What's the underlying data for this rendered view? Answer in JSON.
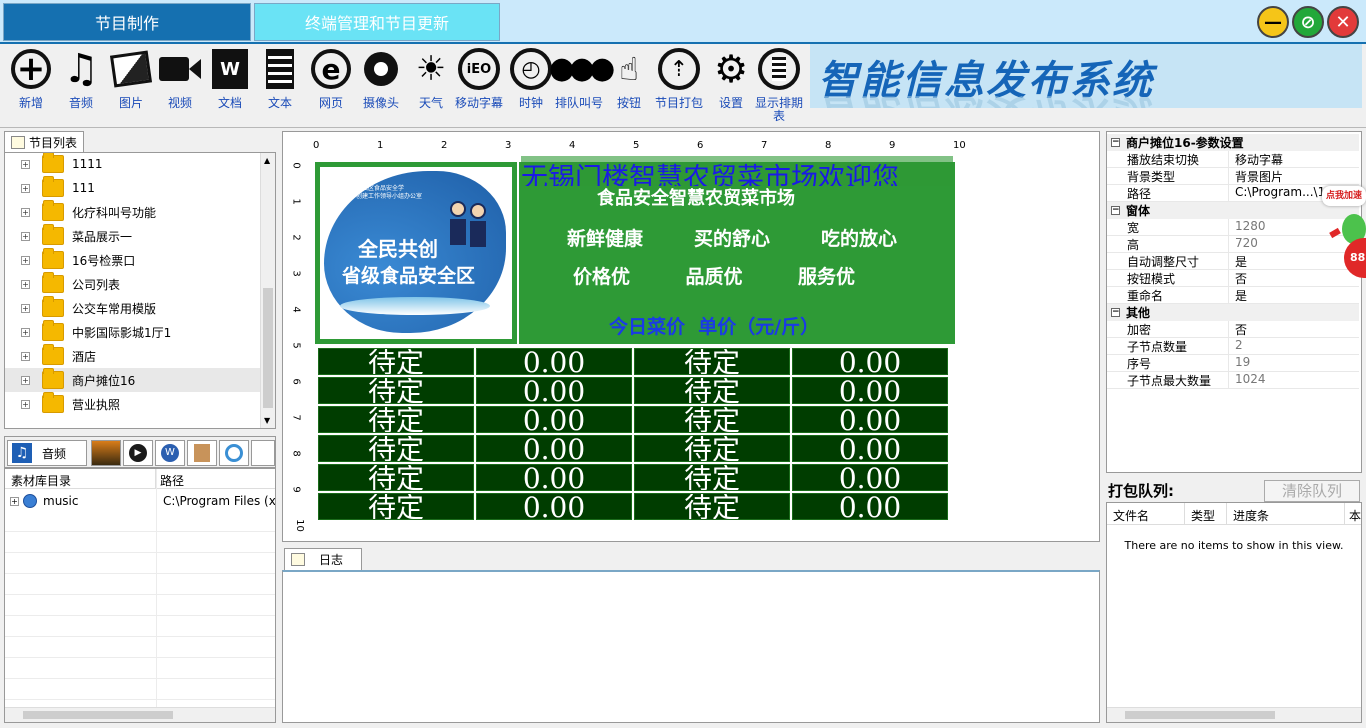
{
  "tabs": {
    "program": "节目制作",
    "terminal": "终端管理和节目更新"
  },
  "window_buttons": {
    "minimize": "—",
    "maximize": "⊘",
    "close": "✕"
  },
  "toolbar": [
    {
      "label": "新增",
      "icon": "add-icon"
    },
    {
      "label": "音频",
      "icon": "music-icon"
    },
    {
      "label": "图片",
      "icon": "picture-icon"
    },
    {
      "label": "视频",
      "icon": "video-icon"
    },
    {
      "label": "文档",
      "icon": "word-doc-icon"
    },
    {
      "label": "文本",
      "icon": "text-icon"
    },
    {
      "label": "网页",
      "icon": "web-icon"
    },
    {
      "label": "摄像头",
      "icon": "camera-icon"
    },
    {
      "label": "天气",
      "icon": "weather-icon"
    },
    {
      "label": "移动字幕",
      "icon": "marquee-icon"
    },
    {
      "label": "时钟",
      "icon": "clock-icon"
    },
    {
      "label": "排队叫号",
      "icon": "queue-icon"
    },
    {
      "label": "按钮",
      "icon": "button-icon"
    },
    {
      "label": "节目打包",
      "icon": "package-icon"
    },
    {
      "label": "设置",
      "icon": "gear-icon"
    },
    {
      "label": "显示排期表",
      "icon": "schedule-icon"
    }
  ],
  "brand": "智能信息发布系统",
  "program_list": {
    "title": "节目列表",
    "items": [
      "1111",
      "111",
      "化疗科叫号功能",
      "菜品展示一",
      "16号检票口",
      "公司列表",
      "公交车常用模版",
      "中影国际影城1厅1",
      "酒店",
      "商户摊位16",
      "营业执照"
    ]
  },
  "media": {
    "active_tab": "音频",
    "columns": [
      "素材库目录",
      "路径"
    ],
    "rows": [
      {
        "name": "music",
        "path": "C:\\Program Files (x8"
      }
    ]
  },
  "canvas": {
    "ruler_x": [
      "0",
      "1",
      "2",
      "3",
      "4",
      "5",
      "6",
      "7",
      "8",
      "9",
      "10"
    ],
    "ruler_y": [
      "0",
      "1",
      "2",
      "3",
      "4",
      "5",
      "6",
      "7",
      "8",
      "9",
      "10"
    ],
    "marquee": "无锡门楼智慧农贸菜市场欢迎您",
    "logo_small": "梁山区食品安全学\n创建工作领导小组办公室",
    "logo_line1": "全民共创",
    "logo_line2": "省级食品安全区",
    "market_title": "食品安全智慧农贸菜市场",
    "slogan1": [
      "新鲜健康",
      "买的舒心",
      "吃的放心"
    ],
    "slogan2": [
      "价格优",
      "品质优",
      "服务优"
    ],
    "today_label": "今日菜价  单价（元/斤）",
    "cell_pending": "待定",
    "cell_price": "0.00"
  },
  "log": {
    "title": "日志"
  },
  "properties": {
    "header": "商户摊位16-参数设置",
    "groups": [
      {
        "name": "",
        "rows": [
          [
            "播放结束切换",
            "移动字幕"
          ],
          [
            "背景类型",
            "背景图片"
          ],
          [
            "路径",
            "C:\\Program...\\111"
          ]
        ]
      },
      {
        "name": "窗体",
        "rows": [
          [
            "宽",
            "1280"
          ],
          [
            "高",
            "720"
          ],
          [
            "自动调整尺寸",
            "是"
          ],
          [
            "按钮模式",
            "否"
          ],
          [
            "重命名",
            "是"
          ]
        ]
      },
      {
        "name": "其他",
        "rows": [
          [
            "加密",
            "否"
          ],
          [
            "子节点数量",
            "2"
          ],
          [
            "序号",
            "19"
          ],
          [
            "子节点最大数量",
            "1024"
          ]
        ]
      }
    ]
  },
  "pack_queue": {
    "title": "打包队列:",
    "clear_button": "清除队列",
    "columns": [
      "文件名",
      "类型",
      "进度条",
      "本"
    ],
    "empty": "There are no items to show in this view."
  },
  "floating": {
    "badge_text": "点我加速",
    "number": "88"
  }
}
